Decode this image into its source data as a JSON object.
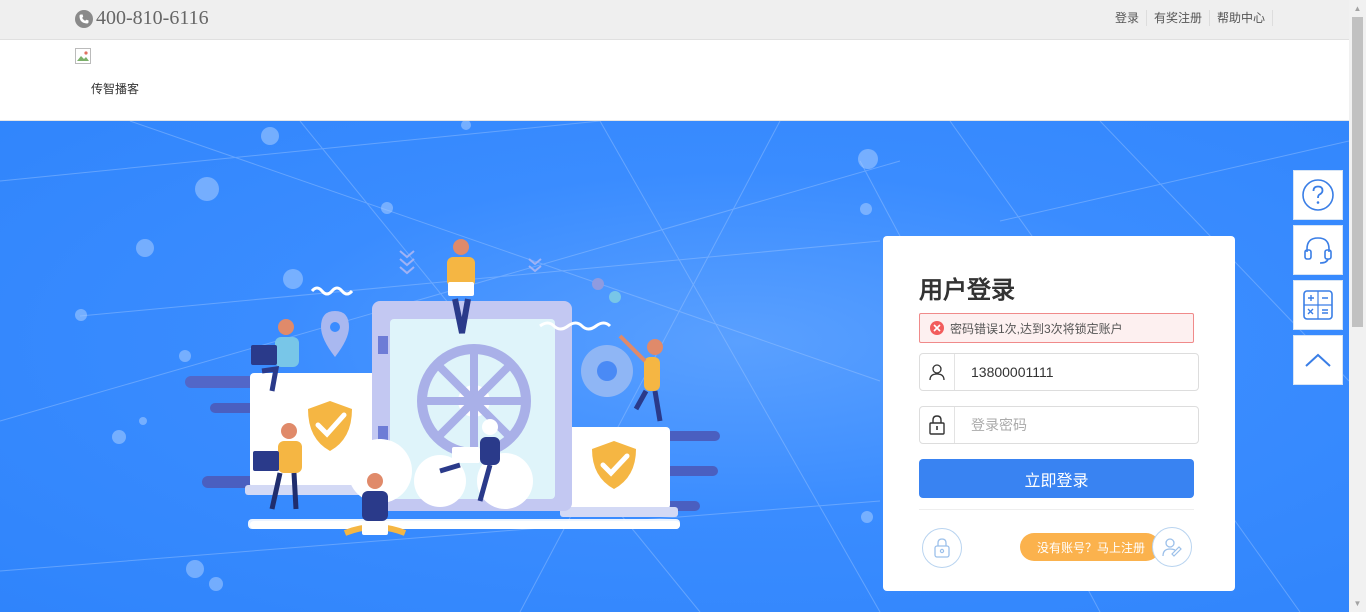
{
  "topbar": {
    "phone": "400-810-6116",
    "links": [
      "登录",
      "有奖注册",
      "帮助中心"
    ]
  },
  "header": {
    "logo_text": "传智播客"
  },
  "login": {
    "title": "用户登录",
    "error_message": "密码错误1次,达到3次将锁定账户",
    "username_value": "13800001111",
    "password_placeholder": "登录密码",
    "submit_label": "立即登录",
    "register_label": "没有账号？马上注册"
  },
  "side_tools": [
    "help-icon",
    "headset-icon",
    "calculator-icon",
    "back-to-top-icon"
  ],
  "colors": {
    "banner_blue": "#2f84fb",
    "button_blue": "#3983f2",
    "register_orange": "#fbb24d",
    "error_red": "#f25c5c"
  }
}
